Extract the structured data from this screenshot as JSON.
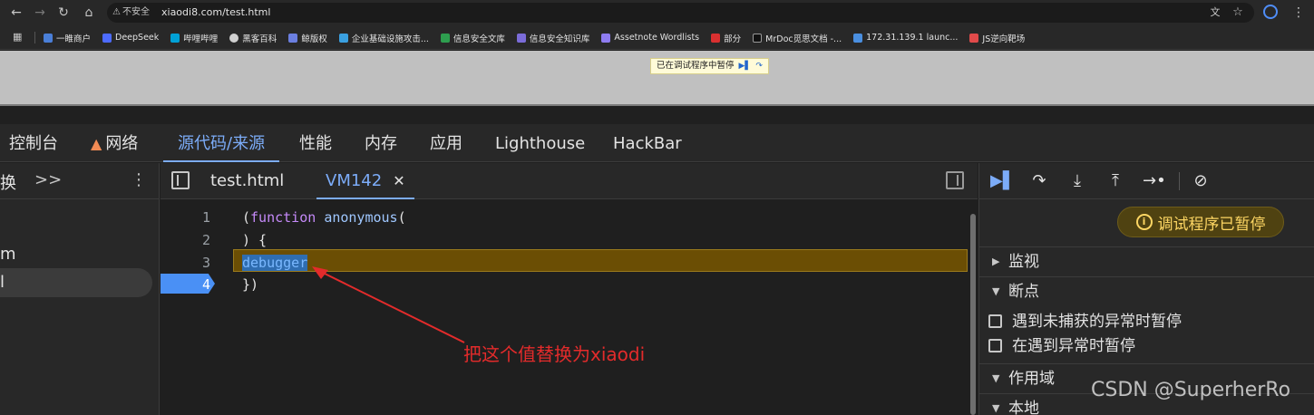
{
  "browser": {
    "security_label": "不安全",
    "url": "xiaodi8.com/test.html",
    "bookmarks": [
      "一睢商户",
      "DeepSeek",
      "哔哩哔哩",
      "黑客百科",
      "鲸版权",
      "企业基础设施攻击...",
      "信息安全文库",
      "信息安全知识库",
      "Assetnote Wordlists",
      "部分",
      "MrDoc觅思文档 -...",
      "172.31.139.1 launc...",
      "JS逆向靶场"
    ]
  },
  "page": {
    "paused_overlay": "已在调试程序中暂停"
  },
  "devtools": {
    "tabs": [
      "控制台",
      "网络",
      "源代码/来源",
      "性能",
      "内存",
      "应用",
      "Lighthouse",
      "HackBar"
    ],
    "active_tab": "源代码/来源",
    "navigator": {
      "tab_label": "换",
      "more": ">>",
      "items": [
        "m",
        "l"
      ]
    },
    "editor": {
      "tabs": [
        "test.html",
        "VM142"
      ],
      "active_tab": "VM142",
      "lines": [
        {
          "n": "1",
          "t": "(function anonymous("
        },
        {
          "n": "2",
          "t": ") {"
        },
        {
          "n": "3",
          "t": "debugger"
        },
        {
          "n": "4",
          "t": "})"
        }
      ],
      "current_line": 4,
      "highlight_line": 3
    },
    "debugger": {
      "paused_badge": "调试程序已暂停",
      "sections": [
        "监视",
        "断点",
        "作用域",
        "本地"
      ],
      "checkboxes": [
        "遇到未捕获的异常时暂停",
        "在遇到异常时暂停"
      ]
    }
  },
  "annotation": {
    "text": "把这个值替换为xiaodi"
  },
  "watermark": "CSDN @SuperherRo",
  "colors": {
    "accent": "#7cacf8",
    "paused_yellow": "#fdd663",
    "annotation_red": "#e32b2b"
  }
}
